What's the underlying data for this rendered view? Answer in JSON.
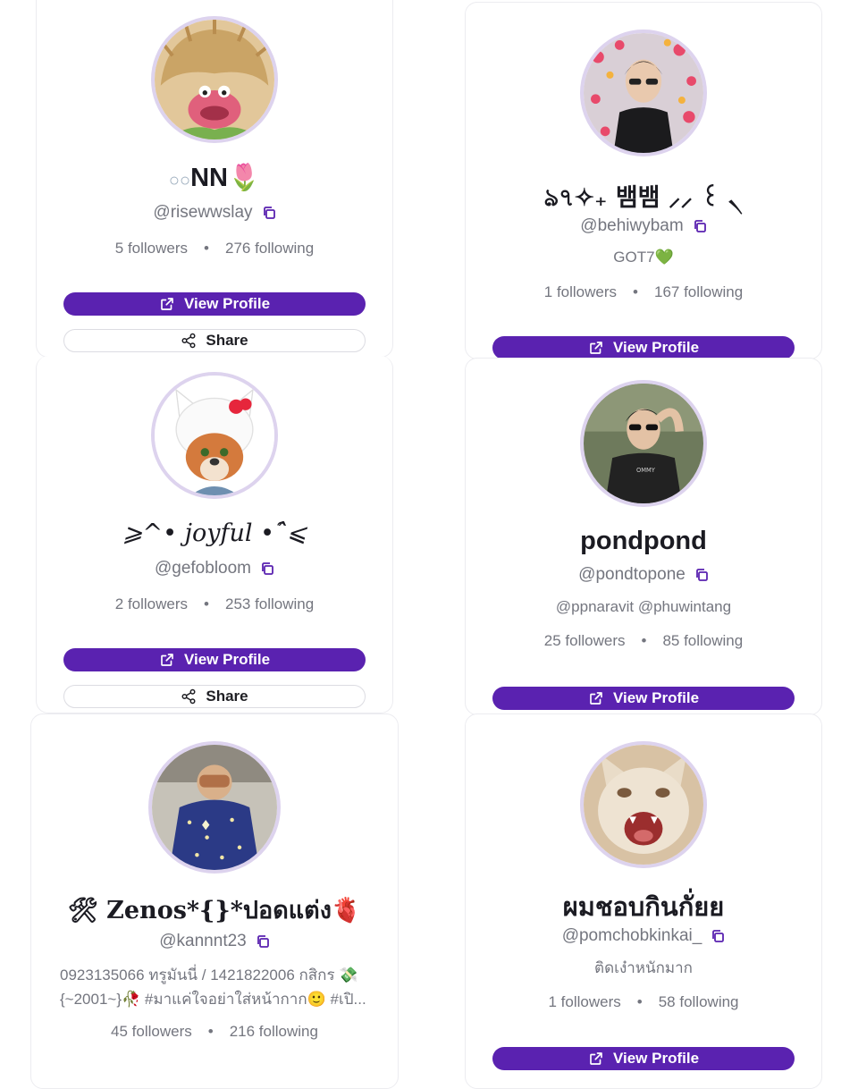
{
  "actions": {
    "view_profile": "View Profile",
    "share": "Share"
  },
  "accent": "#5a22b0",
  "profiles": [
    {
      "name": "NN",
      "name_prefix": "○○",
      "name_suffix": "🌷",
      "handle": "@risewwslay",
      "followers": "5 followers",
      "following": "276 following",
      "avatar": "fuzzy-puppet-avatar",
      "separator": "•"
    },
    {
      "name": "ঌ৭✧₊ 뱀뱀 ⸝⸝ ꒰ ৲",
      "handle": "@behiwybam",
      "bio": "GOT7💚",
      "followers": "1 followers",
      "following": "167 following",
      "avatar": "man-hearts-avatar",
      "separator": "•"
    },
    {
      "name": "⩾^• 𝑗𝑜𝑦𝑓𝑢𝑙 •ˆ̑⩽",
      "handle": "@gefobloom",
      "followers": "2 followers",
      "following": "253 following",
      "avatar": "fox-kitty-hat-avatar",
      "separator": "•"
    },
    {
      "name": "pondpond",
      "handle": "@pondtopone",
      "bio": "@ppnaravit @phuwintang",
      "followers": "25 followers",
      "following": "85 following",
      "avatar": "man-sunglasses-avatar",
      "separator": "•"
    },
    {
      "name": "🛠 Zenos*{}*ปอดแต่ง🫀",
      "handle": "@kannnt23",
      "bio_line1": "0923135066 ทรูมันนี่ / 1421822006 กสิกร 💸",
      "bio_line2": "{~2001~}🥀 #มาแค่ใจอย่าใส่หน้ากาก🙂 #เปิ...",
      "followers": "45 followers",
      "following": "216 following",
      "avatar": "person-starry-blanket-avatar",
      "separator": "•"
    },
    {
      "name": "ผมชอบกินกั่ยย",
      "handle": "@pomchobkinkai_",
      "bio": "ติดเง๋าหนักมาก",
      "followers": "1 followers",
      "following": "58 following",
      "avatar": "screaming-cat-avatar",
      "separator": "•"
    }
  ]
}
